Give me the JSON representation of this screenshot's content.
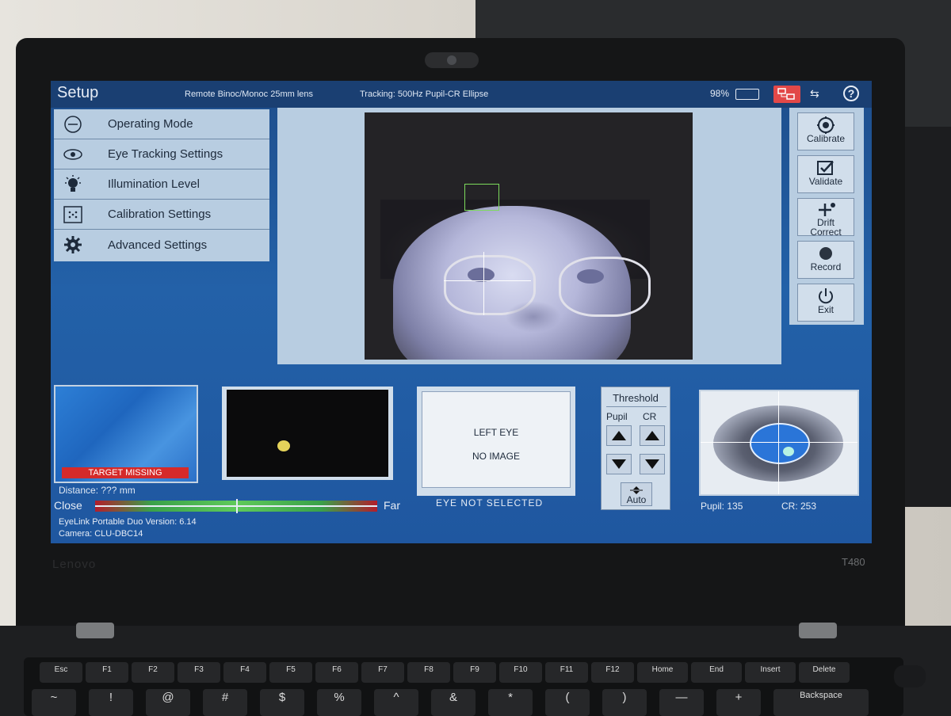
{
  "header": {
    "title": "Setup",
    "config": "Remote Binoc/Monoc 25mm lens",
    "tracking": "Tracking: 500Hz Pupil-CR Ellipse",
    "battery": "98%",
    "help": "?"
  },
  "menu": {
    "items": [
      {
        "label": "Operating Mode",
        "icon": "operating-mode-icon"
      },
      {
        "label": "Eye Tracking Settings",
        "icon": "eye-icon"
      },
      {
        "label": "Illumination Level",
        "icon": "bulb-icon"
      },
      {
        "label": "Calibration Settings",
        "icon": "calibration-grid-icon"
      },
      {
        "label": "Advanced Settings",
        "icon": "gear-icon"
      }
    ]
  },
  "right_buttons": [
    {
      "label": "Calibrate",
      "icon": "target-icon"
    },
    {
      "label": "Validate",
      "icon": "checkbox-icon"
    },
    {
      "label": "Drift Correct",
      "icon": "plus-icon"
    },
    {
      "label": "Record",
      "icon": "record-icon"
    },
    {
      "label": "Exit",
      "icon": "power-icon"
    }
  ],
  "target": {
    "status": "TARGET MISSING",
    "distance": "Distance: ??? mm",
    "close": "Close",
    "far": "Far"
  },
  "info": {
    "version": "EyeLink Portable Duo Version: 6.14",
    "camera": "Camera: CLU-DBC14"
  },
  "left_eye": {
    "line1": "LEFT EYE",
    "line2": "NO IMAGE",
    "status": "EYE NOT SELECTED"
  },
  "threshold": {
    "title": "Threshold",
    "pupil": "Pupil",
    "cr": "CR",
    "auto": "Auto"
  },
  "eye_camera": {
    "pupil": "Pupil: 135",
    "cr": "CR: 253"
  },
  "laptop": {
    "brand": "Lenovo",
    "model": "T480"
  },
  "keys": {
    "row1": [
      "Esc",
      "F1",
      "F2",
      "F3",
      "F4",
      "F5",
      "F6",
      "F7",
      "F8",
      "F9",
      "F10",
      "F11",
      "F12",
      "Home",
      "End",
      "Insert",
      "Delete"
    ],
    "row2": [
      "~",
      "!",
      "@",
      "#",
      "$",
      "%",
      "^",
      "&",
      "*",
      "(",
      ")",
      "—",
      "+",
      "Backspace"
    ]
  },
  "colors": {
    "screen_bg": "#2361a8",
    "panel": "#b8cde1",
    "alert": "#d52a2a",
    "pupil": "#2a75d8"
  }
}
